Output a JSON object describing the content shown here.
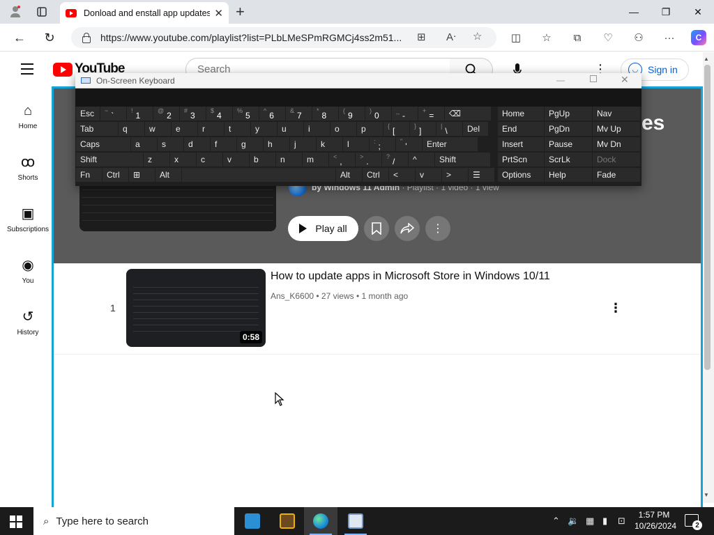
{
  "browser": {
    "tab_title": "Donload and enstall app updates",
    "url": "https://www.youtube.com/playlist?list=PLbLMeSPmRGMCj4ss2m51..."
  },
  "youtube": {
    "logo_text": "YouTube",
    "search_placeholder": "Search",
    "sign_in": "Sign in",
    "sidebar": [
      {
        "label": "Home",
        "icon": "home-icon"
      },
      {
        "label": "Shorts",
        "icon": "shorts-icon"
      },
      {
        "label": "Subscriptions",
        "icon": "subscriptions-icon"
      },
      {
        "label": "You",
        "icon": "you-icon"
      },
      {
        "label": "History",
        "icon": "history-icon"
      }
    ],
    "playlist": {
      "title_tail": "es",
      "owner": "by Windows 11 Admin",
      "meta": " · Playlist · 1 video · 1 view",
      "play_all": "Play all"
    },
    "video": {
      "index": "1",
      "title": "How to update apps in Microsoft Store in Windows 10/11",
      "channel": "Ans_K6600",
      "meta": " • 27 views • 1 month ago",
      "duration": "0:58"
    }
  },
  "osk": {
    "title": "On-Screen Keyboard",
    "rows": [
      [
        {
          "main": "Esc"
        },
        {
          "shift": "~",
          "main": "`"
        },
        {
          "shift": "!",
          "main": "1"
        },
        {
          "shift": "@",
          "main": "2"
        },
        {
          "shift": "#",
          "main": "3"
        },
        {
          "shift": "$",
          "main": "4"
        },
        {
          "shift": "%",
          "main": "5"
        },
        {
          "shift": "^",
          "main": "6"
        },
        {
          "shift": "&",
          "main": "7"
        },
        {
          "shift": "*",
          "main": "8"
        },
        {
          "shift": "(",
          "main": "9"
        },
        {
          "shift": ")",
          "main": "0"
        },
        {
          "shift": "_",
          "main": "-"
        },
        {
          "shift": "+",
          "main": "="
        },
        {
          "main": "⌫"
        }
      ],
      [
        {
          "main": "Tab"
        },
        {
          "main": "q"
        },
        {
          "main": "w"
        },
        {
          "main": "e"
        },
        {
          "main": "r"
        },
        {
          "main": "t"
        },
        {
          "main": "y"
        },
        {
          "main": "u"
        },
        {
          "main": "i"
        },
        {
          "main": "o"
        },
        {
          "main": "p"
        },
        {
          "shift": "{",
          "main": "["
        },
        {
          "shift": "}",
          "main": "]"
        },
        {
          "shift": "|",
          "main": "\\"
        },
        {
          "main": "Del"
        }
      ],
      [
        {
          "main": "Caps"
        },
        {
          "main": "a"
        },
        {
          "main": "s"
        },
        {
          "main": "d"
        },
        {
          "main": "f"
        },
        {
          "main": "g"
        },
        {
          "main": "h"
        },
        {
          "main": "j"
        },
        {
          "main": "k"
        },
        {
          "main": "l"
        },
        {
          "shift": ":",
          "main": ";"
        },
        {
          "shift": "\"",
          "main": "'"
        },
        {
          "main": "Enter"
        }
      ],
      [
        {
          "main": "Shift"
        },
        {
          "main": "z"
        },
        {
          "main": "x"
        },
        {
          "main": "c"
        },
        {
          "main": "v"
        },
        {
          "main": "b"
        },
        {
          "main": "n"
        },
        {
          "main": "m"
        },
        {
          "shift": "<",
          "main": ","
        },
        {
          "shift": ">",
          "main": "."
        },
        {
          "shift": "?",
          "main": "/"
        },
        {
          "main": "^"
        },
        {
          "main": "Shift"
        }
      ],
      [
        {
          "main": "Fn"
        },
        {
          "main": "Ctrl"
        },
        {
          "main": "⊞"
        },
        {
          "main": "Alt"
        },
        {
          "main": ""
        },
        {
          "main": "Alt"
        },
        {
          "main": "Ctrl"
        },
        {
          "main": "<"
        },
        {
          "main": "v"
        },
        {
          "main": ">"
        },
        {
          "main": "☰"
        }
      ]
    ],
    "nav_keys": [
      [
        "Home",
        "PgUp",
        "Nav"
      ],
      [
        "End",
        "PgDn",
        "Mv Up"
      ],
      [
        "Insert",
        "Pause",
        "Mv Dn"
      ],
      [
        "PrtScn",
        "ScrLk",
        "Dock"
      ],
      [
        "Options",
        "Help",
        "Fade"
      ]
    ]
  },
  "taskbar": {
    "search_placeholder": "Type here to search",
    "time": "1:57 PM",
    "date": "10/26/2024",
    "notifications": "2"
  },
  "colors": {
    "highlight": "#16a4d8",
    "youtube_red": "#ff0000",
    "link_blue": "#065fd4"
  }
}
